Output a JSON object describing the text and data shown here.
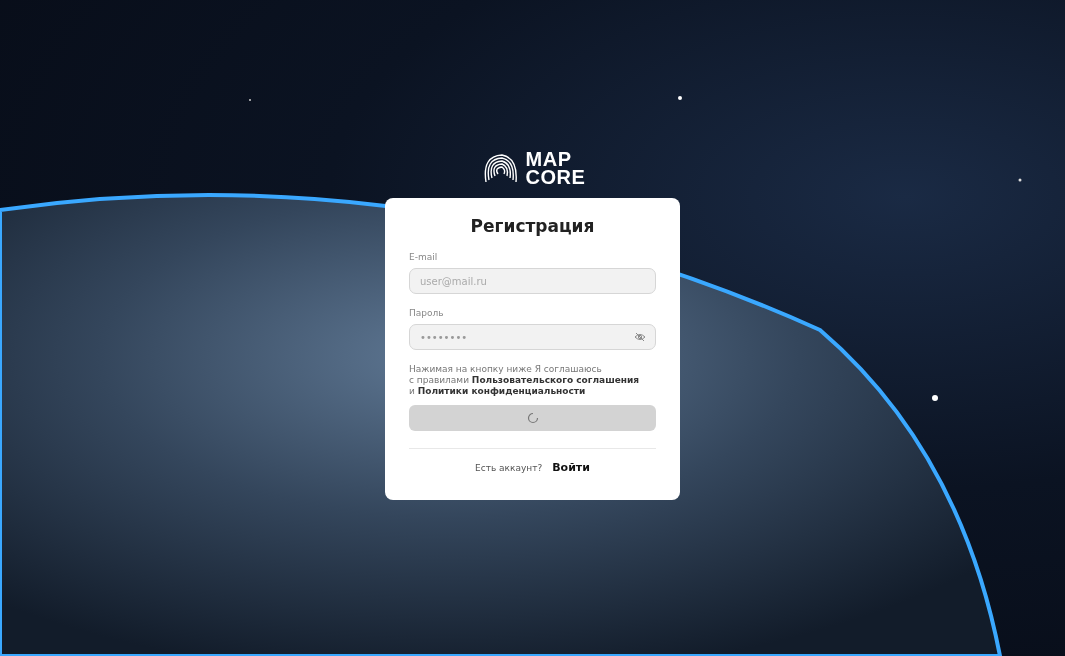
{
  "logo": {
    "line_1": "MAP",
    "line_2": "CORE"
  },
  "form": {
    "title": "Регистрация",
    "fields": [
      {
        "kind": "text",
        "label": "E-mail",
        "placeholder": "user@mail.ru"
      },
      {
        "kind": "password",
        "label": "Пароль",
        "value": "••••••••"
      }
    ],
    "agreement": "Нажимая на кнопку ниже Я соглашаюсь\n с правилами **Пользовательского соглашения**\n и **Политики конфиденциальности**",
    "submit": {
      "loading": true,
      "disabled": true
    },
    "footer": {
      "question": "Есть аккаунт?",
      "link": "Войти"
    }
  }
}
